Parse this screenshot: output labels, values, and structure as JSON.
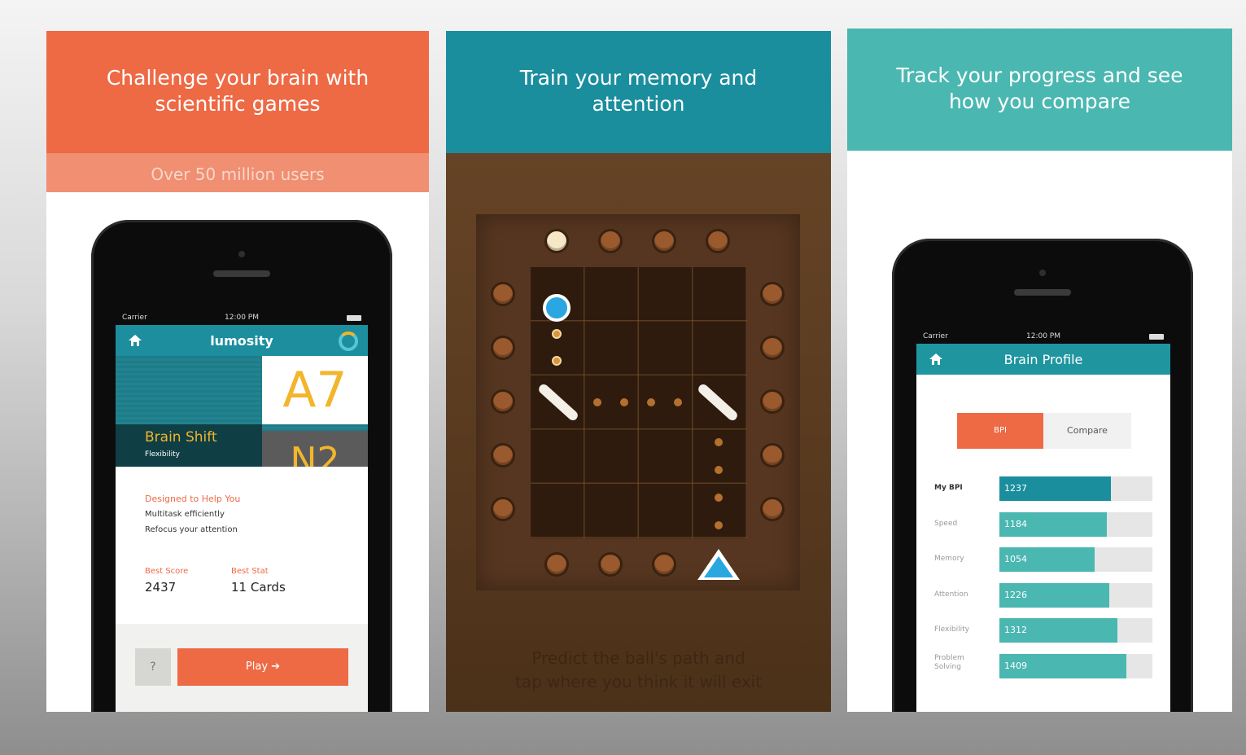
{
  "panel1": {
    "headline": "Challenge your brain with scientific games",
    "subbar": "Over 50 million users",
    "phone": {
      "status": {
        "carrier": "Carrier",
        "time": "12:00 PM"
      },
      "nav_title": "lumosity",
      "card_letters": "A7",
      "card_letters_2": "N2",
      "game_title": "Brain Shift",
      "game_subtitle": "Flexibility",
      "designed_heading": "Designed to Help You",
      "benefits": [
        "Multitask efficiently",
        "Refocus your attention"
      ],
      "best_score_label": "Best Score",
      "best_score_value": "2437",
      "best_stat_label": "Best Stat",
      "best_stat_value": "11 Cards",
      "help_button": "?",
      "play_button": "Play ➔"
    }
  },
  "panel2": {
    "headline": "Train your memory and attention",
    "caption_line1": "Predict the ball's path and",
    "caption_line2": "tap where you think it will exit"
  },
  "panel3": {
    "headline": "Track your progress and see how you compare",
    "phone": {
      "status": {
        "carrier": "Carrier",
        "time": "12:00 PM"
      },
      "nav_title": "Brain Profile",
      "tab_bpi": "BPI",
      "tab_compare": "Compare",
      "rows": [
        {
          "label": "My BPI",
          "value": "1237",
          "fill": 0.73
        },
        {
          "label": "Speed",
          "value": "1184",
          "fill": 0.7
        },
        {
          "label": "Memory",
          "value": "1054",
          "fill": 0.62
        },
        {
          "label": "Attention",
          "value": "1226",
          "fill": 0.72
        },
        {
          "label": "Flexibility",
          "value": "1312",
          "fill": 0.77
        },
        {
          "label": "Problem Solving",
          "value": "1409",
          "fill": 0.83
        }
      ]
    }
  },
  "colors": {
    "orange": "#ee6a45",
    "orange_light": "#f08f72",
    "teal_dark": "#1b8e9e",
    "teal_light": "#4ab7b1",
    "ball_blue": "#2aa7e1",
    "card_yellow": "#f2b52c"
  }
}
